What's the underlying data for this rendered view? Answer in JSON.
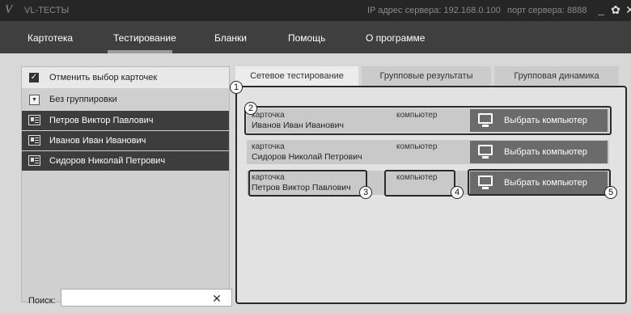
{
  "titlebar": {
    "logo": "V",
    "app_title": "VL-ТЕСТЫ",
    "server_ip": "IP адрес сервера: 192.168.0.100",
    "server_port": "порт сервера: 8888"
  },
  "menu": [
    "Картотека",
    "Тестирование",
    "Бланки",
    "Помощь",
    "О программе"
  ],
  "active_menu": "Тестирование",
  "left": {
    "cancel_label": "Отменить выбор карточек",
    "cancel_checked": true,
    "grouping_label": "Без группировки",
    "people": [
      "Петров Виктор Павлович",
      "Иванов Иван Иванович",
      "Сидоров Николай Петрович"
    ],
    "search_label": "Поиск:",
    "search_value": "",
    "clear_glyph": "✕"
  },
  "tabs": [
    "Сетевое тестирование",
    "Групповые результаты",
    "Групповая динамика"
  ],
  "active_tab": "Сетевое тестирование",
  "rows": [
    {
      "card_label": "карточка",
      "name": "Иванов Иван Иванович",
      "computer_label": "компьютер",
      "button": "Выбрать компьютер"
    },
    {
      "card_label": "карточка",
      "name": "Сидоров Николай Петрович",
      "computer_label": "компьютер",
      "button": "Выбрать компьютер"
    },
    {
      "card_label": "карточка",
      "name": "Петров Виктор Павлович",
      "computer_label": "компьютер",
      "button": "Выбрать компьютер"
    }
  ],
  "callouts": [
    "1",
    "2",
    "3",
    "4",
    "5"
  ],
  "icons": {
    "logo": "logo-icon",
    "minimize": "minimize-icon",
    "settings": "gear-icon",
    "close": "close-icon",
    "monitor": "monitor-icon",
    "card": "card-icon"
  }
}
